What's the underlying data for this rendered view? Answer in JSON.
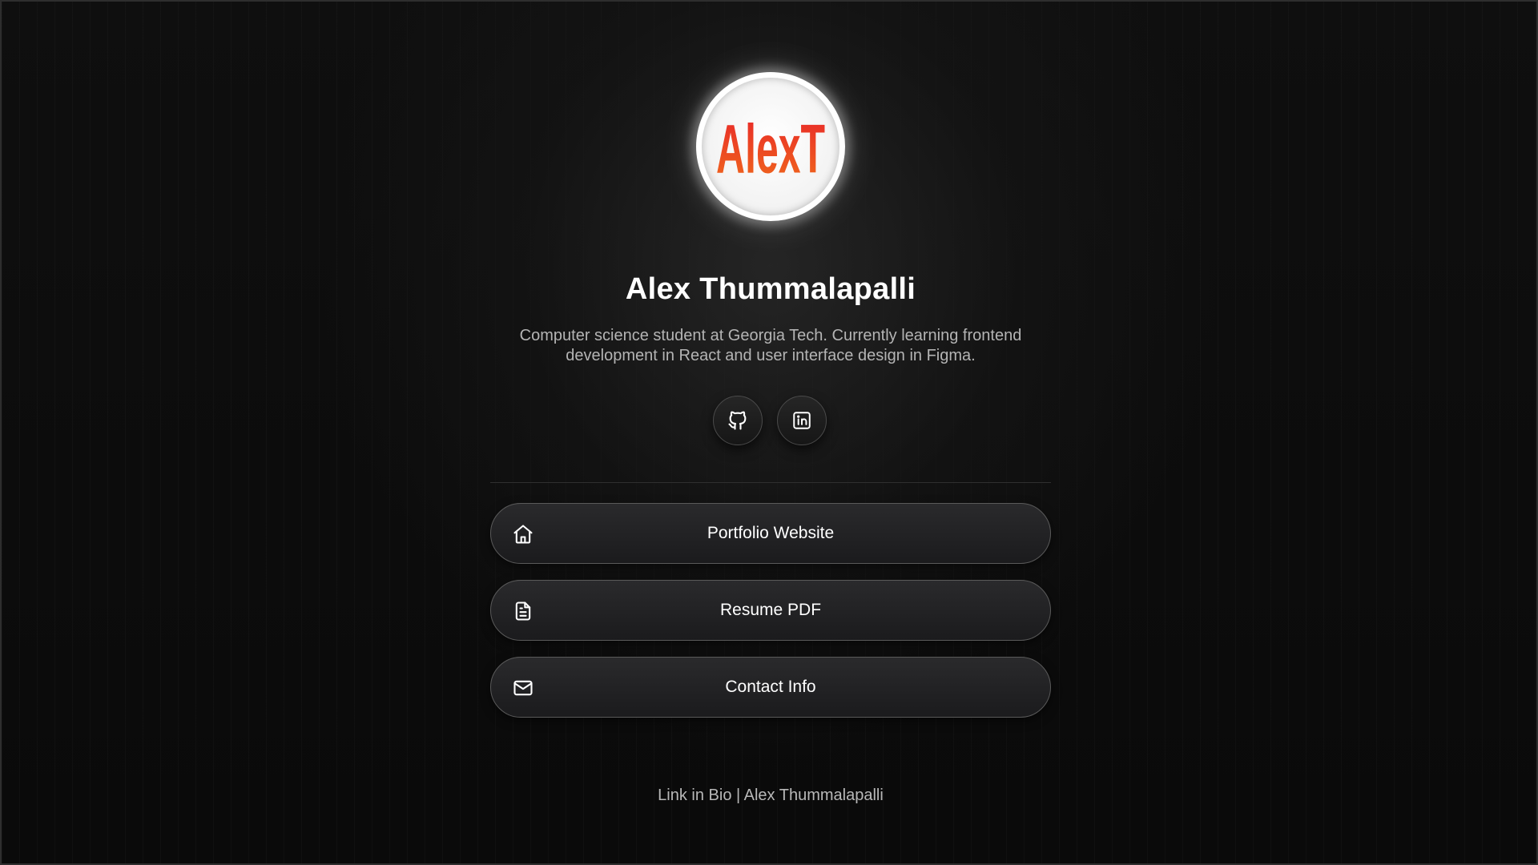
{
  "profile": {
    "logo_text": "AlexT",
    "name": "Alex Thummalapalli",
    "bio": "Computer science student at Georgia Tech. Currently learning frontend development in React and user interface design in Figma."
  },
  "social": [
    {
      "icon": "github-icon"
    },
    {
      "icon": "linkedin-icon"
    }
  ],
  "links": [
    {
      "label": "Portfolio Website",
      "icon": "home-icon"
    },
    {
      "label": "Resume PDF",
      "icon": "document-icon"
    },
    {
      "label": "Contact Info",
      "icon": "mail-icon"
    }
  ],
  "footer": {
    "text": "Link in Bio | Alex Thummalapalli"
  },
  "colors": {
    "background": "#0b0b0b",
    "logo_red": "#e8262a",
    "logo_orange": "#f06a1c",
    "text_primary": "#ffffff",
    "text_muted": "#b4b4b4"
  }
}
